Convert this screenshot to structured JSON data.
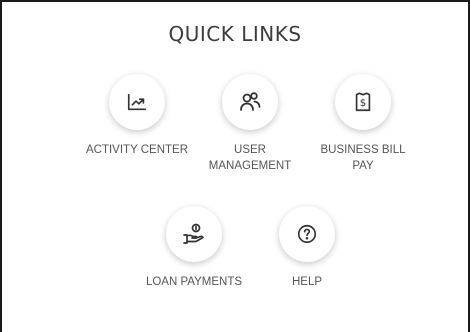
{
  "quick_links": {
    "title": "QUICK LINKS",
    "items": [
      {
        "label": "ACTIVITY CENTER",
        "icon": "trend-chart-icon"
      },
      {
        "label": "USER MANAGEMENT",
        "icon": "users-icon"
      },
      {
        "label": "BUSINESS BILL PAY",
        "icon": "bill-dollar-icon"
      },
      {
        "label": "LOAN PAYMENTS",
        "icon": "hand-coin-icon"
      },
      {
        "label": "HELP",
        "icon": "question-circle-icon"
      }
    ]
  },
  "colors": {
    "text": "#555555",
    "title": "#3c3c3c",
    "icon": "#333333",
    "border": "#1a1a1a"
  }
}
